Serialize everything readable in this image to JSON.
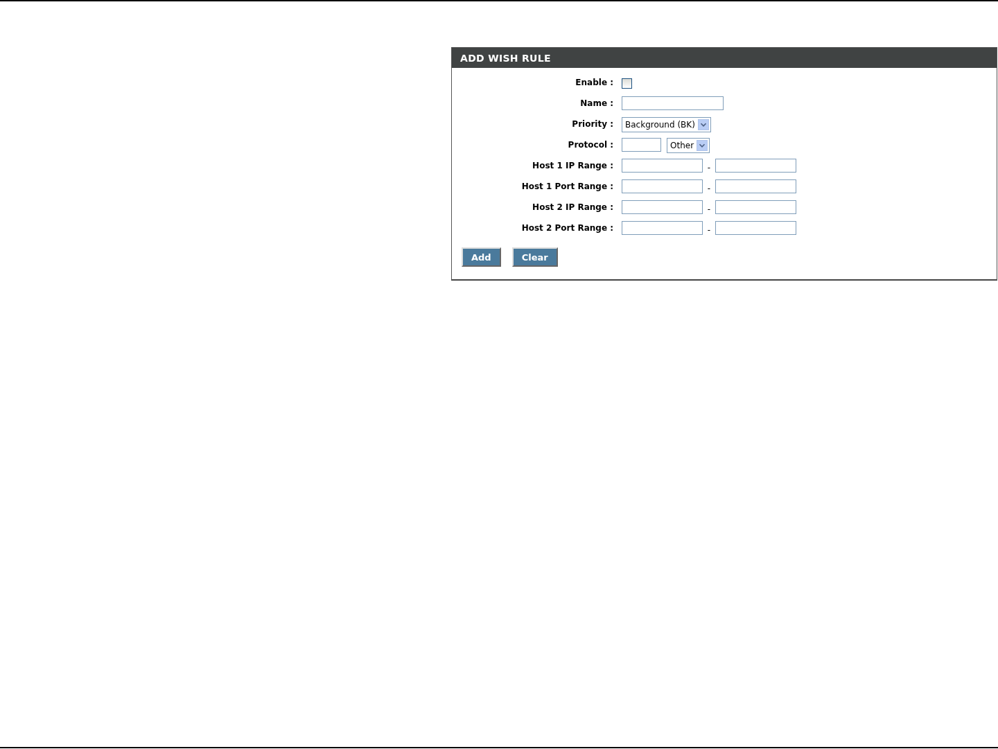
{
  "panel": {
    "title": "ADD WISH RULE",
    "fields": [
      {
        "kind": "checkbox",
        "label": "Enable :",
        "checked": false
      },
      {
        "kind": "text",
        "label": "Name :"
      },
      {
        "kind": "select",
        "label": "Priority :",
        "value": "Background (BK)"
      },
      {
        "kind": "protocol",
        "label": "Protocol :",
        "value": "Other"
      },
      {
        "kind": "range",
        "label": "Host 1 IP Range :",
        "separator": "-"
      },
      {
        "kind": "range",
        "label": "Host 1 Port Range :",
        "separator": "-"
      },
      {
        "kind": "range",
        "label": "Host 2 IP Range :",
        "separator": "-"
      },
      {
        "kind": "range",
        "label": "Host 2 Port Range :",
        "separator": "-"
      }
    ],
    "buttons": [
      "Add",
      "Clear"
    ]
  }
}
